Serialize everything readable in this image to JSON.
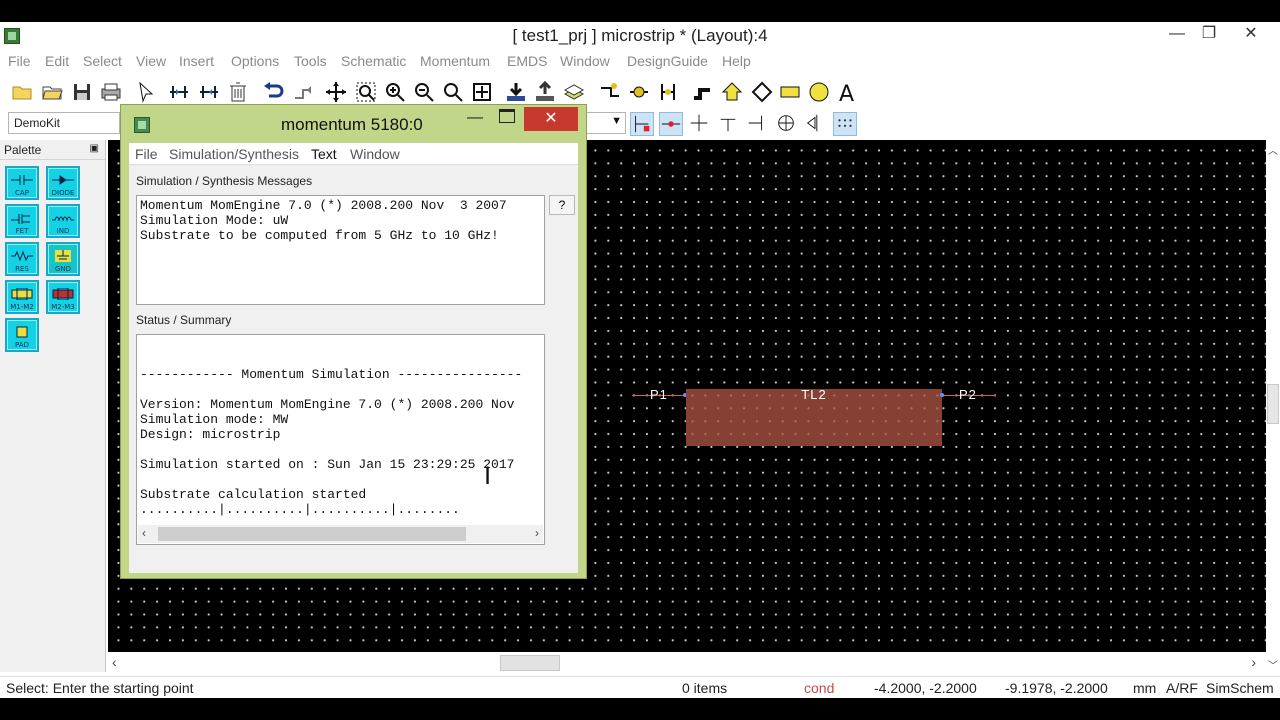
{
  "window": {
    "title": "[ test1_prj ] microstrip * (Layout):4",
    "minimize": "—",
    "restore": "❐",
    "close": "✕"
  },
  "menu": [
    "File",
    "Edit",
    "Select",
    "View",
    "Insert",
    "Options",
    "Tools",
    "Schematic",
    "Momentum",
    "EMDS",
    "Window",
    "DesignGuide",
    "Help"
  ],
  "toolbar2": {
    "library_combo": "DemoKit"
  },
  "palette": {
    "header": "Palette",
    "items": [
      "CAP",
      "DIODE",
      "FET",
      "IND",
      "RES",
      "GND",
      "M1-M2",
      "M2-M3",
      "PAD"
    ]
  },
  "layout": {
    "component_label": "TL2",
    "port1": "P1",
    "port2": "P2"
  },
  "statusbar": {
    "prompt": "Select: Enter the starting point",
    "items": "0 items",
    "layer": "cond",
    "coord1": "-4.2000, -2.2000",
    "coord2": "-9.1978, -2.2000",
    "units": "mm",
    "mode": "A/RF",
    "sim": "SimSchem"
  },
  "dialog": {
    "title": "momentum 5180:0",
    "menu": [
      "File",
      "Simulation/Synthesis",
      "Text",
      "Window"
    ],
    "messages_label": "Simulation / Synthesis Messages",
    "messages": "Momentum MomEngine 7.0 (*) 2008.200 Nov  3 2007\nSimulation Mode: uW\nSubstrate to be computed from 5 GHz to 10 GHz!",
    "help_button": "?",
    "status_label": "Status / Summary",
    "status": "------------ Momentum Simulation ----------------\n\nVersion: Momentum MomEngine 7.0 (*) 2008.200 Nov\nSimulation mode: MW\nDesign: microstrip\n\nSimulation started on : Sun Jan 15 23:29:25 2017\n\nSubstrate calculation started\n..........|..........|..........|........"
  },
  "colors": {
    "dialog_frame": "#c2d68a",
    "close_button": "#c7392e",
    "palette_item": "#14d2e6",
    "conductor": "#874034",
    "canvas": "#000000"
  }
}
